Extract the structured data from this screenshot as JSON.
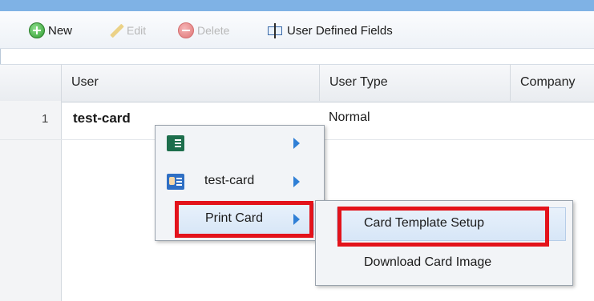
{
  "toolbar": {
    "new_label": "New",
    "edit_label": "Edit",
    "delete_label": "Delete",
    "udf_label": "User Defined Fields"
  },
  "grid": {
    "columns": [
      "User",
      "User Type",
      "Company"
    ],
    "rows": [
      {
        "num": "1",
        "user": "test-card",
        "user_type": "Normal"
      }
    ]
  },
  "context_menu": {
    "items": [
      {
        "label": "",
        "icon": "card-list-icon",
        "has_submenu": true
      },
      {
        "label": "test-card",
        "icon": "id-card-icon",
        "has_submenu": true
      },
      {
        "label": "Print Card",
        "icon": "",
        "has_submenu": true
      }
    ]
  },
  "submenu": {
    "items": [
      {
        "label": "Card Template Setup"
      },
      {
        "label": "Download Card Image"
      }
    ]
  },
  "colors": {
    "highlight": "#e3131b",
    "arrow": "#2f7fd6",
    "topbar": "#7fb2e5"
  }
}
